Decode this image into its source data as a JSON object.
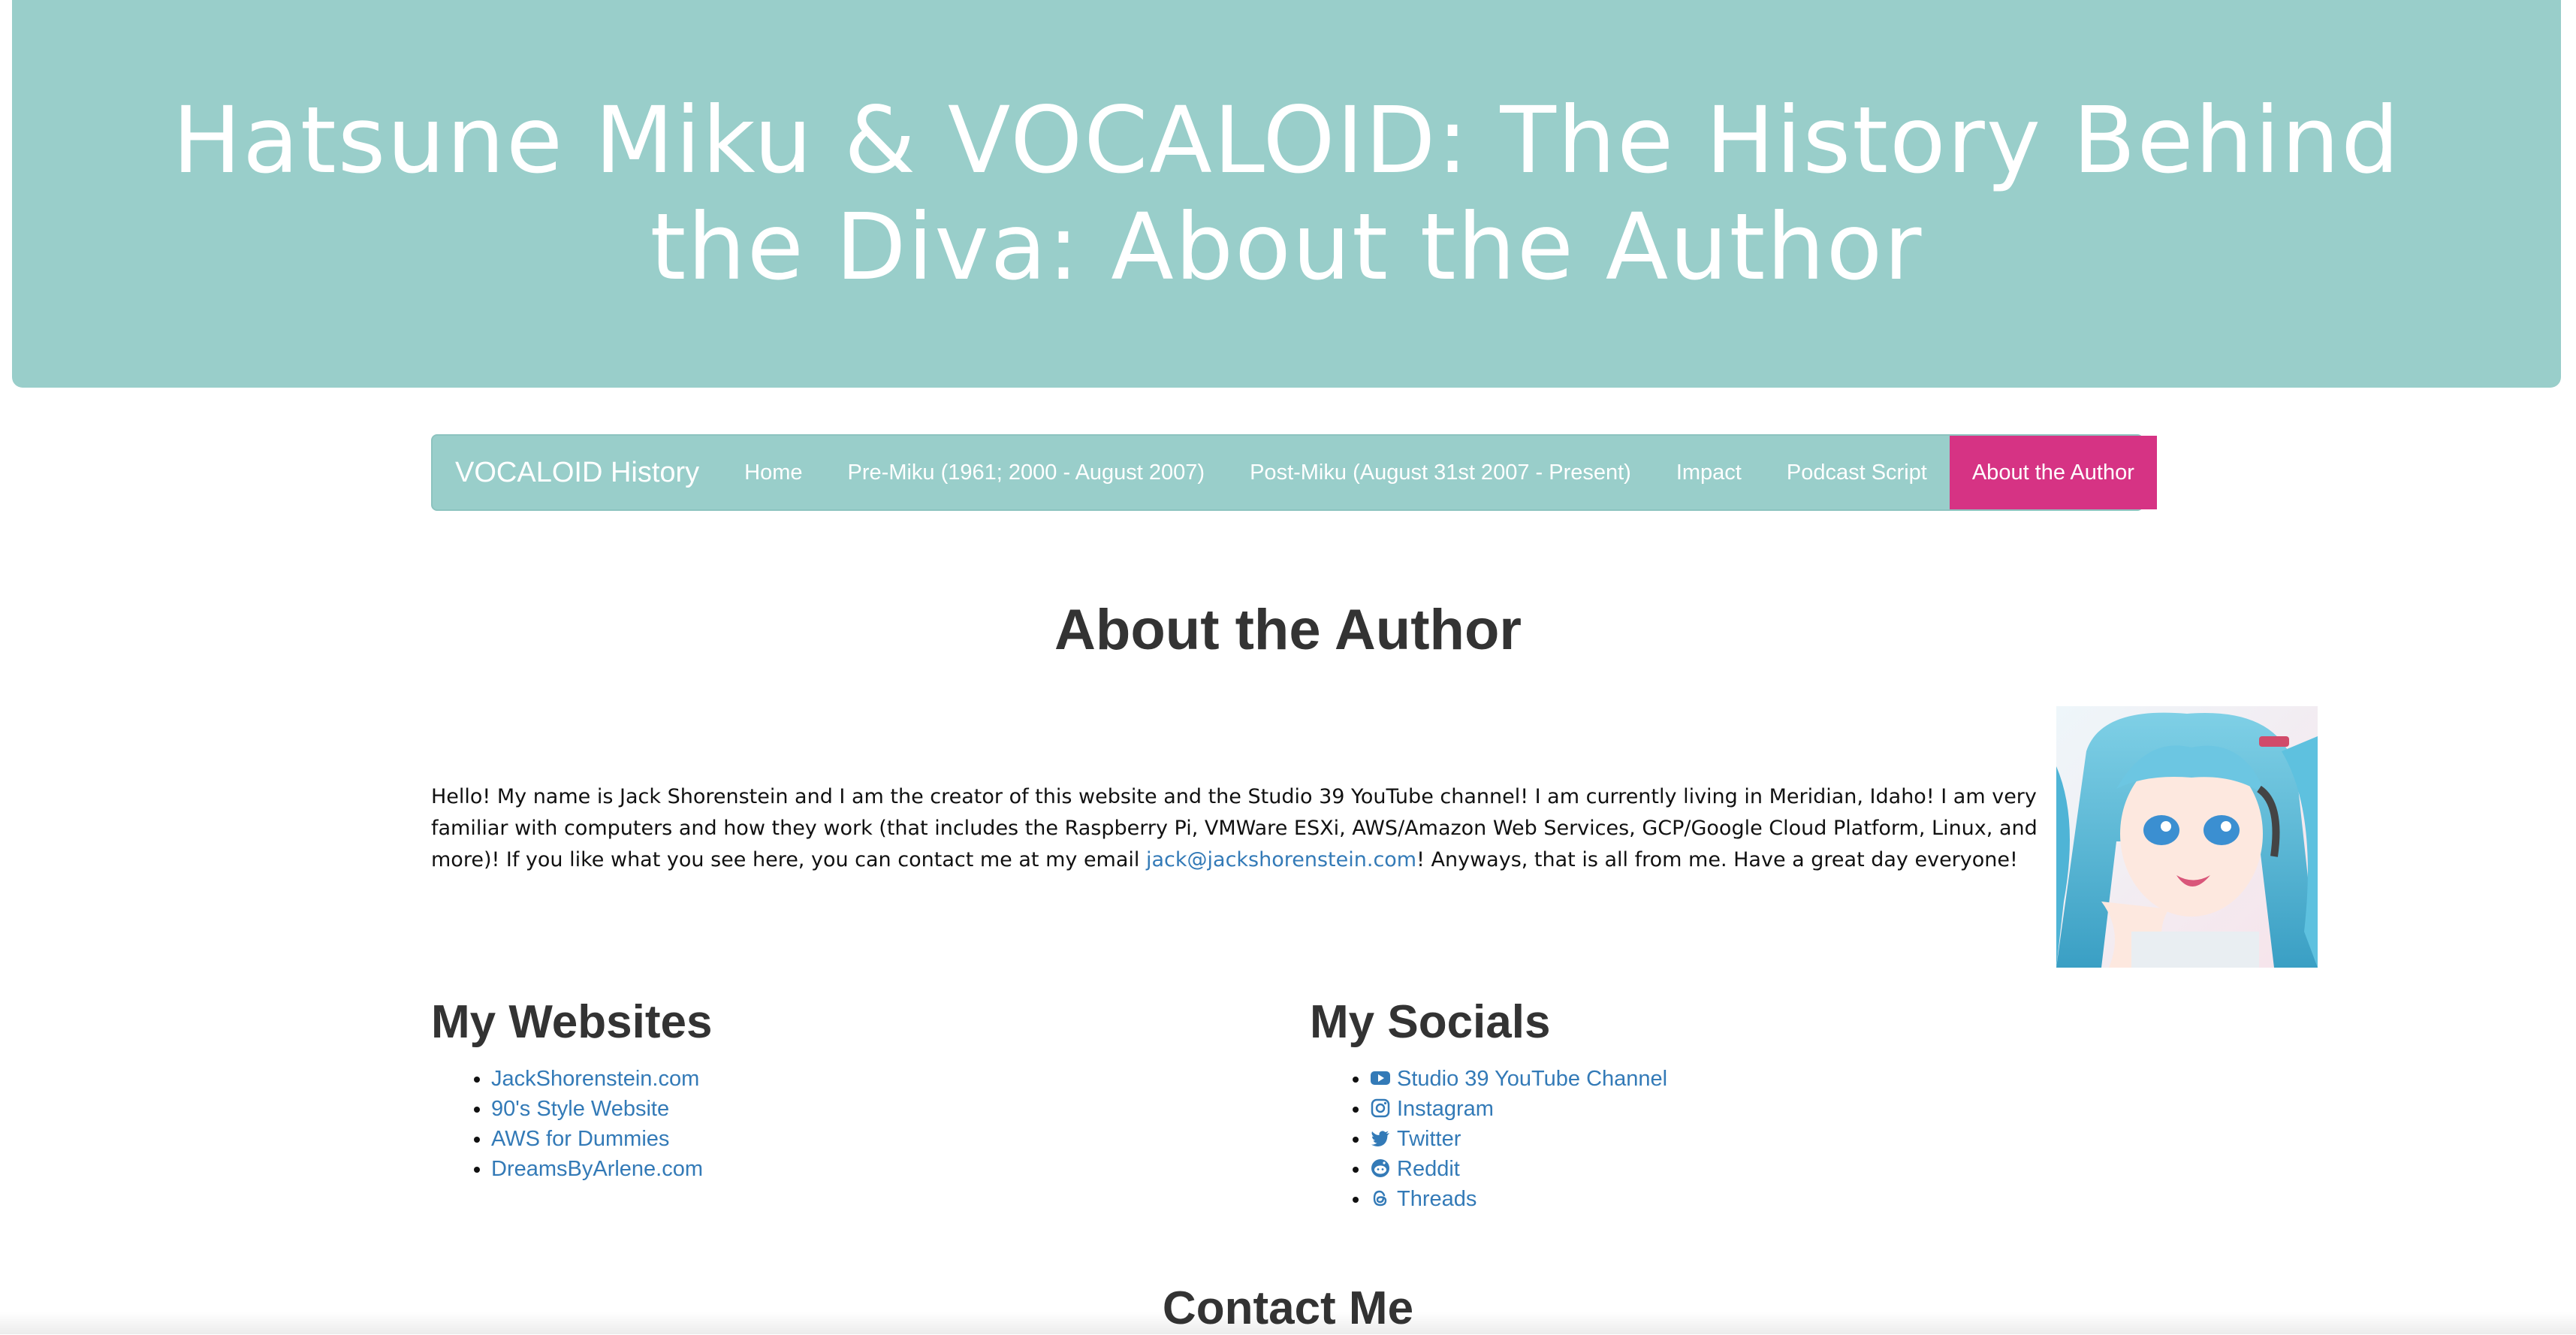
{
  "header": {
    "title": "Hatsune Miku & VOCALOID: The History Behind the Diva: About the Author"
  },
  "navbar": {
    "brand": "VOCALOID History",
    "items": [
      {
        "label": "Home"
      },
      {
        "label": "Pre-Miku (1961; 2000 - August 2007)"
      },
      {
        "label": "Post-Miku (August 31st 2007 - Present)"
      },
      {
        "label": "Impact"
      },
      {
        "label": "Podcast Script"
      },
      {
        "label": "About the Author",
        "active": true
      }
    ]
  },
  "main": {
    "title": "About the Author",
    "intro_before": "Hello! My name is Jack Shorenstein and I am the creator of this website and the Studio 39 YouTube channel! I am currently living in Meridian, Idaho! I am very familiar with computers and how they work (that includes the Raspberry Pi, VMWare ESXi, AWS/Amazon Web Services, GCP/Google Cloud Platform, Linux, and more)! If you like what you see here, you can contact me at my email ",
    "email": "jack@jackshorenstein.com",
    "intro_after": "! Anyways, that is all from me. Have a great day everyone!"
  },
  "websites": {
    "heading": "My Websites",
    "links": [
      {
        "label": "JackShorenstein.com"
      },
      {
        "label": "90's Style Website"
      },
      {
        "label": "AWS for Dummies"
      },
      {
        "label": "DreamsByArlene.com"
      }
    ]
  },
  "socials": {
    "heading": "My Socials",
    "links": [
      {
        "label": "Studio 39 YouTube Channel",
        "icon": "youtube-icon"
      },
      {
        "label": "Instagram",
        "icon": "instagram-icon"
      },
      {
        "label": "Twitter",
        "icon": "twitter-icon"
      },
      {
        "label": "Reddit",
        "icon": "reddit-icon"
      },
      {
        "label": "Threads",
        "icon": "threads-icon"
      }
    ]
  },
  "contact": {
    "heading": "Contact Me"
  },
  "colors": {
    "banner": "#99ceca",
    "active_nav": "#d63384",
    "link": "#337ab7"
  }
}
